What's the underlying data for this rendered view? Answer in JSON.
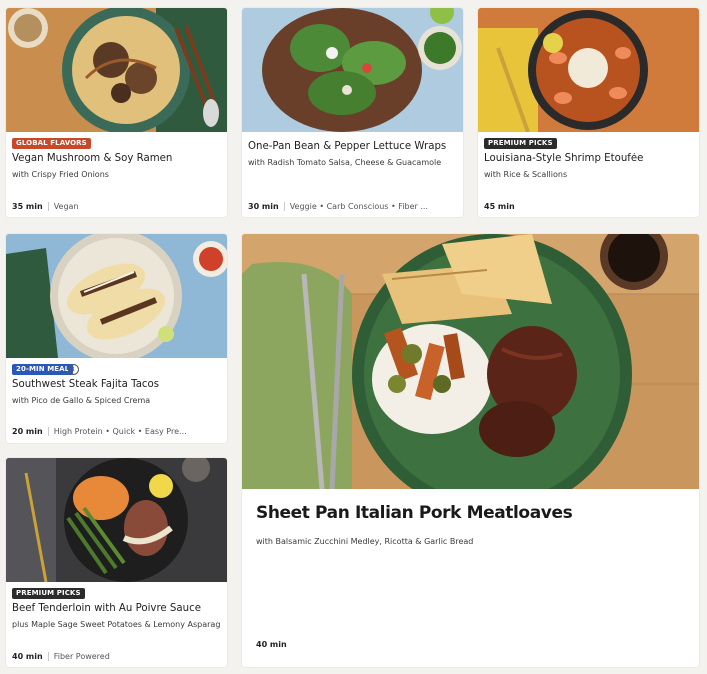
{
  "colors": {
    "badge_global": "#c8492a",
    "badge_premium": "#2b2b2b",
    "badge_20min": "#2a58b8"
  },
  "cards": [
    {
      "badge": "GLOBAL FLAVORS",
      "title": "Vegan Mushroom & Soy Ramen",
      "subtitle": "with Crispy Fried Onions",
      "time": "35 min",
      "tags": "Vegan"
    },
    {
      "badge": "",
      "title": "One-Pan Bean & Pepper Lettuce Wraps",
      "subtitle": "with Radish Tomato Salsa, Cheese & Guacamole",
      "time": "30 min",
      "tags": "Veggie • Carb Conscious • Fiber ..."
    },
    {
      "badge": "PREMIUM PICKS",
      "title": "Louisiana-Style Shrimp Étoufée",
      "subtitle": "with Rice & Scallions",
      "time": "45 min",
      "tags": ""
    },
    {
      "badge": "20-MIN MEAL",
      "title": "Southwest Steak Fajita Tacos",
      "subtitle": "with Pico de Gallo & Spiced Crema",
      "time": "20 min",
      "tags": "High Protein • Quick • Easy Pre..."
    },
    {
      "badge": "PREMIUM PICKS",
      "title": "Beef Tenderloin with Au Poivre Sauce",
      "subtitle": "plus Maple Sage Sweet Potatoes & Lemony Asparagus",
      "time": "40 min",
      "tags": "Fiber Powered"
    },
    {
      "badge": "",
      "title": "Sheet Pan Italian Pork Meatloaves",
      "subtitle": "with Balsamic Zucchini Medley, Ricotta & Garlic Bread",
      "time": "40 min",
      "tags": ""
    }
  ],
  "icons": {
    "info": "i"
  }
}
